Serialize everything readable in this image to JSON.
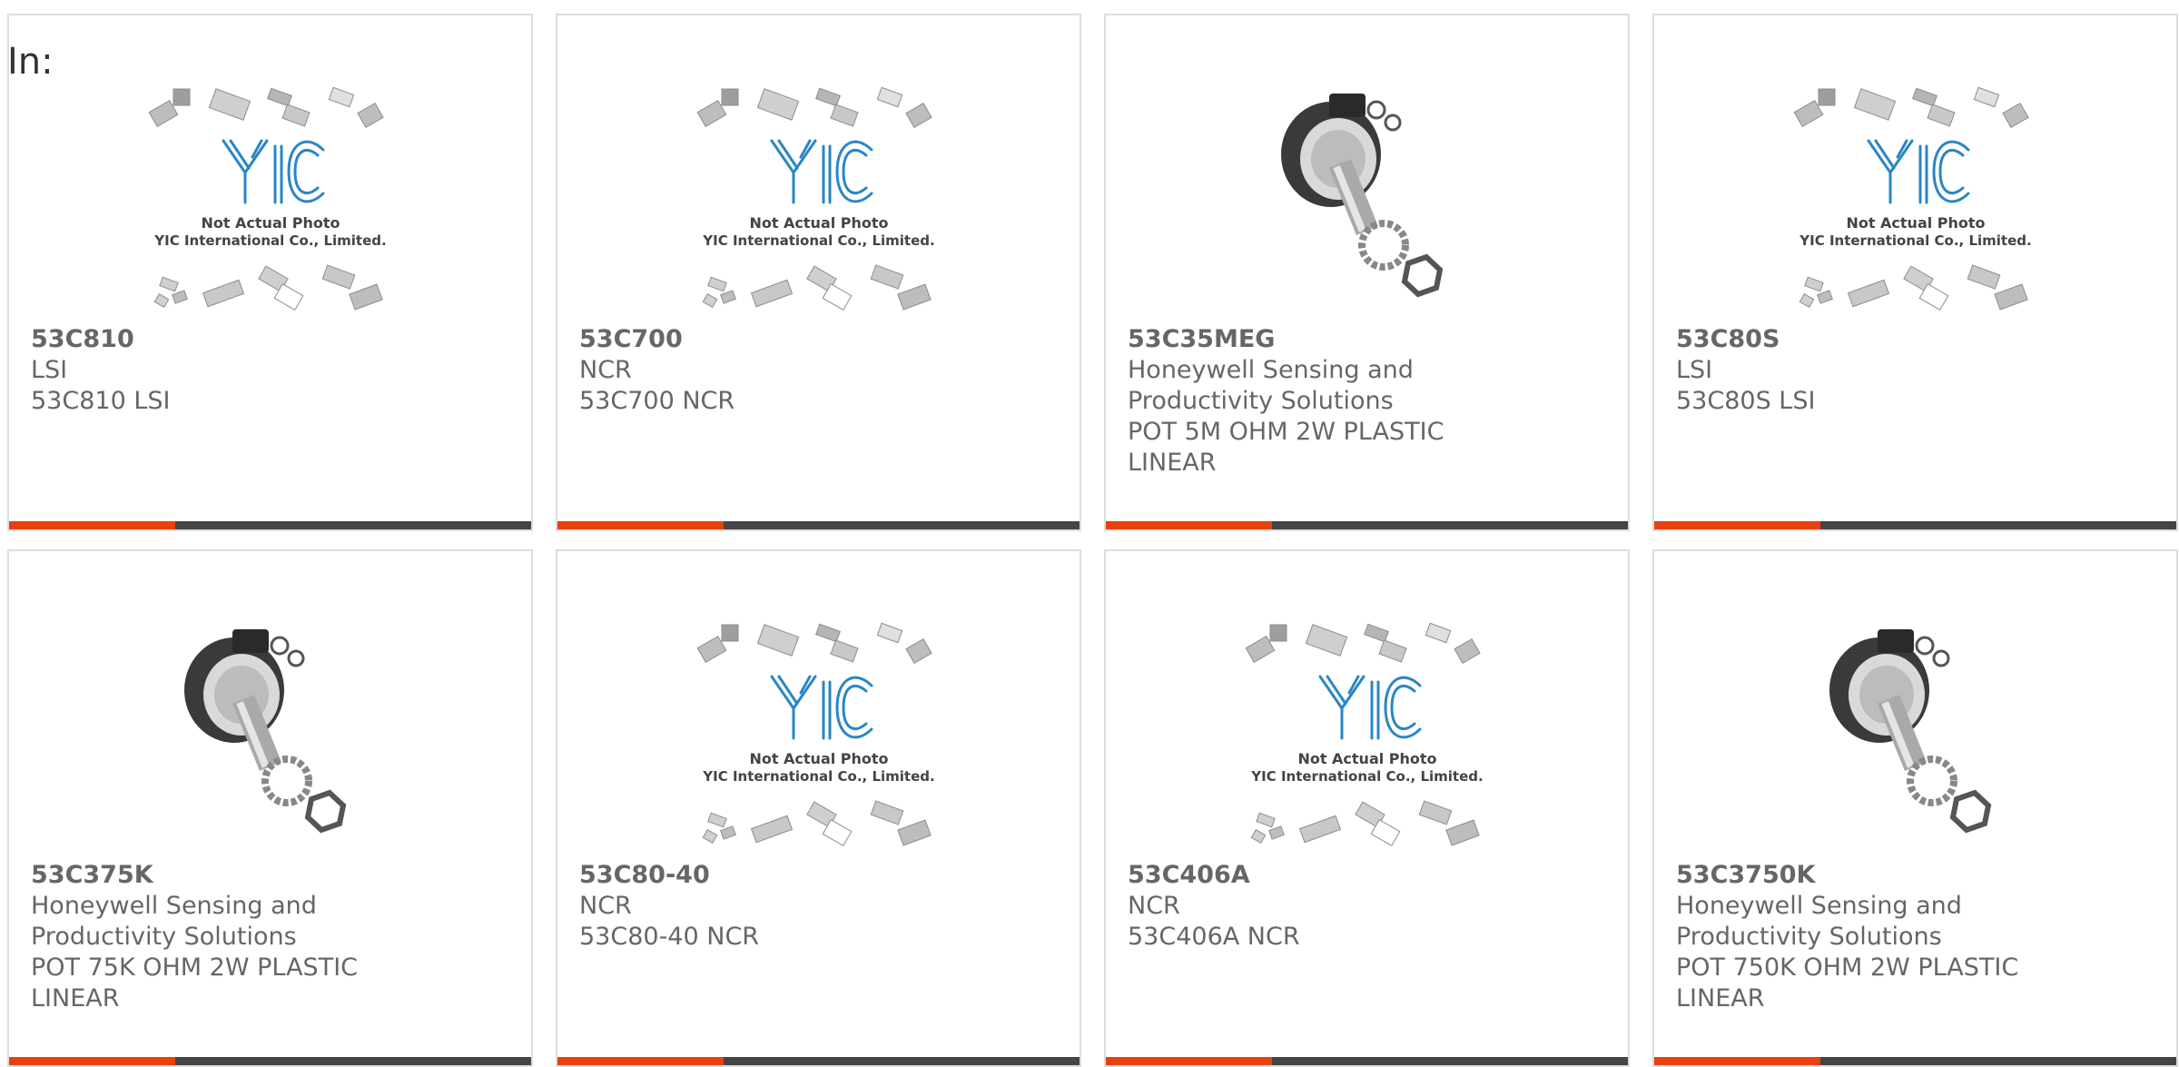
{
  "header": {
    "label": "In:"
  },
  "placeholder_image": {
    "caption_line1": "Not Actual Photo",
    "caption_line2": "YIC International Co., Limited."
  },
  "colors": {
    "accent": "#e8410d",
    "bar": "#444444",
    "logo": "#2a86c4",
    "text": "#666666"
  },
  "products": [
    {
      "part_number": "53C810",
      "manufacturer": "LSI",
      "description": "53C810 LSI",
      "image": "placeholder-logo"
    },
    {
      "part_number": "53C700",
      "manufacturer": "NCR",
      "description": "53C700 NCR",
      "image": "placeholder-logo"
    },
    {
      "part_number": "53C35MEG",
      "manufacturer": "Honeywell Sensing and Productivity Solutions",
      "description": "POT 5M OHM 2W PLASTIC LINEAR",
      "image": "potentiometer-photo"
    },
    {
      "part_number": "53C80S",
      "manufacturer": "LSI",
      "description": "53C80S LSI",
      "image": "placeholder-logo"
    },
    {
      "part_number": "53C375K",
      "manufacturer": "Honeywell Sensing and Productivity Solutions",
      "description": "POT 75K OHM 2W PLASTIC LINEAR",
      "image": "potentiometer-photo"
    },
    {
      "part_number": "53C80-40",
      "manufacturer": "NCR",
      "description": "53C80-40 NCR",
      "image": "placeholder-logo"
    },
    {
      "part_number": "53C406A",
      "manufacturer": "NCR",
      "description": "53C406A NCR",
      "image": "placeholder-logo"
    },
    {
      "part_number": "53C3750K",
      "manufacturer": "Honeywell Sensing and Productivity Solutions",
      "description": "POT 750K OHM 2W PLASTIC LINEAR",
      "image": "potentiometer-photo"
    }
  ]
}
